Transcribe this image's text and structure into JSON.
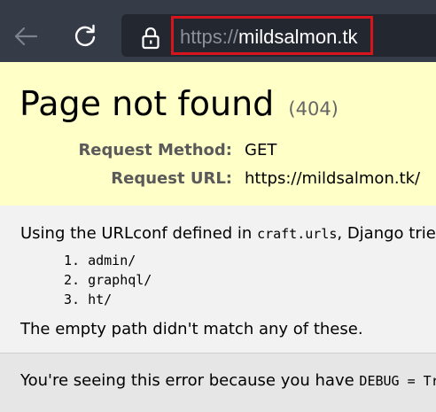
{
  "browser": {
    "url_scheme": "https://",
    "url_host": "mildsalmon.tk"
  },
  "summary": {
    "title": "Page not found",
    "status": "(404)",
    "request_method_label": "Request Method:",
    "request_method_value": "GET",
    "request_url_label": "Request URL:",
    "request_url_value": "https://mildsalmon.tk/"
  },
  "info": {
    "urlconf_prefix": "Using the URLconf defined in ",
    "urlconf_module": "craft.urls",
    "urlconf_suffix": ", Django trie",
    "patterns": [
      "1. admin/",
      "2. graphql/",
      "3. ht/"
    ],
    "no_match": "The empty path didn't match any of these."
  },
  "explanation": {
    "text_prefix": "You're seeing this error because you have ",
    "debug_setting": "DEBUG = Tru"
  },
  "colors": {
    "browser_bar": "#363c47",
    "address_bar": "#23272f",
    "highlight_box": "#d8141d",
    "summary_bg": "#ffffc8",
    "page_bg": "#f2f2f2"
  }
}
